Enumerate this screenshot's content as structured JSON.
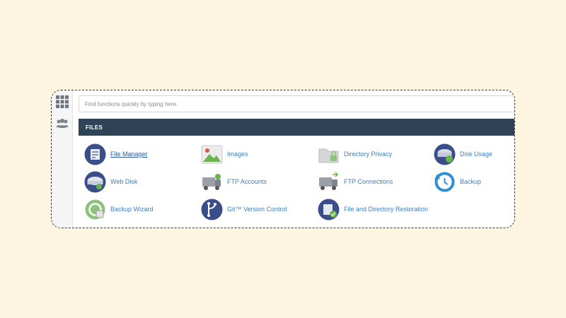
{
  "search": {
    "placeholder": "Find functions quickly by typing here."
  },
  "rail": {
    "icons": [
      "grid-icon",
      "users-icon"
    ]
  },
  "files_section": {
    "title": "FILES",
    "items": [
      {
        "label": "File Manager",
        "icon": "file-manager-icon"
      },
      {
        "label": "Images",
        "icon": "images-icon"
      },
      {
        "label": "Directory Privacy",
        "icon": "directory-privacy-icon"
      },
      {
        "label": "Disk Usage",
        "icon": "disk-usage-icon"
      },
      {
        "label": "Web Disk",
        "icon": "web-disk-icon"
      },
      {
        "label": "FTP Accounts",
        "icon": "ftp-accounts-icon"
      },
      {
        "label": "FTP Connections",
        "icon": "ftp-connections-icon"
      },
      {
        "label": "Backup",
        "icon": "backup-icon"
      },
      {
        "label": "Backup Wizard",
        "icon": "backup-wizard-icon"
      },
      {
        "label": "Git™ Version Control",
        "icon": "git-version-control-icon"
      },
      {
        "label": "File and Directory Restoration",
        "icon": "file-restoration-icon"
      }
    ]
  },
  "colors": {
    "background": "#fdf5df",
    "section_bar": "#2f4357",
    "link": "#3c7fc0",
    "icon_navy": "#3a4f8a",
    "icon_green": "#7fbf6a",
    "icon_blue": "#2e8fd6"
  }
}
